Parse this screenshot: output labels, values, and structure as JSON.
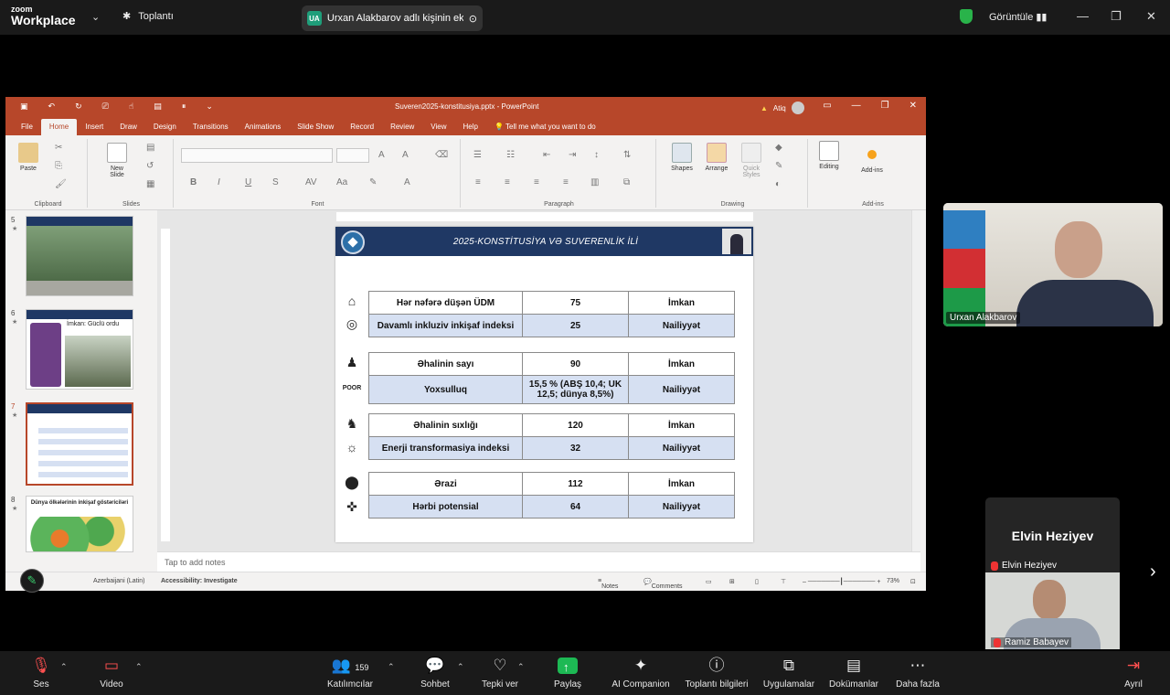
{
  "zoom": {
    "brand_line1": "zoom",
    "brand_line2": "Workplace",
    "meeting_label": "Toplantı",
    "share_initials": "UA",
    "share_label": "Urxan Alakbarov adlı kişinin ekranı",
    "view_label": "Görüntüle"
  },
  "ppt": {
    "file_title": "Suveren2025-konstitusiya.pptx  -  PowerPoint",
    "user": "Atiq",
    "tabs": [
      "File",
      "Home",
      "Insert",
      "Draw",
      "Design",
      "Transitions",
      "Animations",
      "Slide Show",
      "Record",
      "Review",
      "View",
      "Help"
    ],
    "tell_me": "Tell me what you want to do",
    "ribbon": {
      "paste": "Paste",
      "new_slide": "New\nSlide",
      "clipboard": "Clipboard",
      "slides": "Slides",
      "font": "Font",
      "paragraph": "Paragraph",
      "drawing": "Drawing",
      "add_ins_group": "Add-ins",
      "shapes": "Shapes",
      "arrange": "Arrange",
      "quick_styles": "Quick\nStyles",
      "editing": "Editing",
      "add_ins": "Add-ins"
    },
    "thumbnails": [
      {
        "num": "5"
      },
      {
        "num": "6",
        "caption": "İmkan: Güclü ordu"
      },
      {
        "num": "7"
      },
      {
        "num": "8",
        "caption": "Dünya ölkələrinin inkişaf göstəriciləri"
      }
    ],
    "slide": {
      "title": "2025-KONSTİTUSİYA VƏ SUVERENLİK İLİ",
      "groups": [
        {
          "rows": [
            [
              "Hər nəfərə düşən ÜDM",
              "75",
              "İmkan"
            ],
            [
              "Davamlı inkluziv inkişaf indeksi",
              "25",
              "Nailiyyət"
            ]
          ]
        },
        {
          "rows": [
            [
              "Əhalinin sayı",
              "90",
              "İmkan"
            ],
            [
              "Yoxsulluq",
              "15,5 % (ABŞ 10,4; UK 12,5; dünya 8,5%)",
              "Nailiyyət"
            ]
          ]
        },
        {
          "rows": [
            [
              "Əhalinin sıxlığı",
              "120",
              "İmkan"
            ],
            [
              "Enerji transformasiya indeksi",
              "32",
              "Nailiyyət"
            ]
          ]
        },
        {
          "rows": [
            [
              "Ərazi",
              "112",
              "İmkan"
            ],
            [
              "Hərbi potensial",
              "64",
              "Nailiyyət"
            ]
          ]
        }
      ]
    },
    "notes_placeholder": "Tap to add notes",
    "status": {
      "language": "Azerbaijani (Latin)",
      "accessibility": "Accessibility: Investigate",
      "notes": "Notes",
      "comments": "Comments",
      "zoom": "73%"
    }
  },
  "participants": {
    "main": "Urxan Alakbarov",
    "tile_big": "Elvin Heziyev",
    "tile_small": "Elvin Heziyev",
    "tile_video": "Ramiz Babayev"
  },
  "toolbar": {
    "mute": "Ses",
    "video": "Video",
    "participants": "Katılımcılar",
    "participants_count": "159",
    "chat": "Sohbet",
    "react": "Tepki ver",
    "share": "Paylaş",
    "ai": "AI Companion",
    "info": "Toplantı bilgileri",
    "apps": "Uygulamalar",
    "docs": "Dokümanlar",
    "more": "Daha fazla",
    "leave": "Ayrıl"
  }
}
